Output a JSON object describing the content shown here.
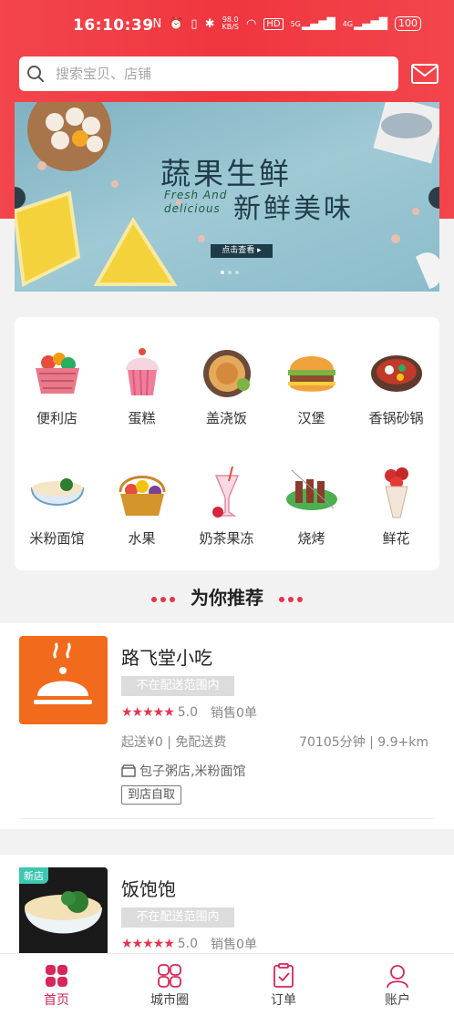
{
  "status_bar": {
    "time": "16:10:39",
    "network_speed": "98.0\nKB/S",
    "battery": "100",
    "net_5g": "5G",
    "net_4g": "4G",
    "hd": "HD"
  },
  "search": {
    "placeholder": "搜索宝贝、店铺"
  },
  "banner": {
    "title": "蔬果生鲜",
    "subtitle_en": "Fresh And\ndelicious",
    "title2": "新鲜美味",
    "button": "点击查看 ▸"
  },
  "categories": [
    {
      "label": "便利店",
      "icon": "grocery-basket-icon"
    },
    {
      "label": "蛋糕",
      "icon": "cupcake-icon"
    },
    {
      "label": "盖浇饭",
      "icon": "rice-plate-icon"
    },
    {
      "label": "汉堡",
      "icon": "burger-icon"
    },
    {
      "label": "香锅砂锅",
      "icon": "hotpot-icon"
    },
    {
      "label": "米粉面馆",
      "icon": "noodle-bowl-icon"
    },
    {
      "label": "水果",
      "icon": "fruit-basket-icon"
    },
    {
      "label": "奶茶果冻",
      "icon": "milk-tea-icon"
    },
    {
      "label": "烧烤",
      "icon": "bbq-skewers-icon"
    },
    {
      "label": "鲜花",
      "icon": "flower-bouquet-icon"
    }
  ],
  "recommend": {
    "title": "为你推荐"
  },
  "stores": [
    {
      "name": "路飞堂小吃",
      "range": "不在配送范围内",
      "rating": "5.0",
      "sales": "销售0单",
      "fee": "起送¥0 | 免配送费",
      "distance": "70105分钟 | 9.9+km",
      "tags": "包子粥店,米粉面馆",
      "pickup": "到店自取"
    },
    {
      "name": "饭饱饱",
      "badge": "新店",
      "range": "不在配送范围内",
      "rating": "5.0",
      "sales": "销售0单"
    }
  ],
  "tabbar": [
    {
      "label": "首页",
      "icon": "home-grid-icon",
      "active": true
    },
    {
      "label": "城市圈",
      "icon": "city-circle-icon",
      "active": false
    },
    {
      "label": "订单",
      "icon": "order-clipboard-icon",
      "active": false
    },
    {
      "label": "账户",
      "icon": "account-person-icon",
      "active": false
    }
  ],
  "colors": {
    "accent": "#e8334f",
    "header": "#f0363f",
    "tab_active": "#d6265a"
  }
}
